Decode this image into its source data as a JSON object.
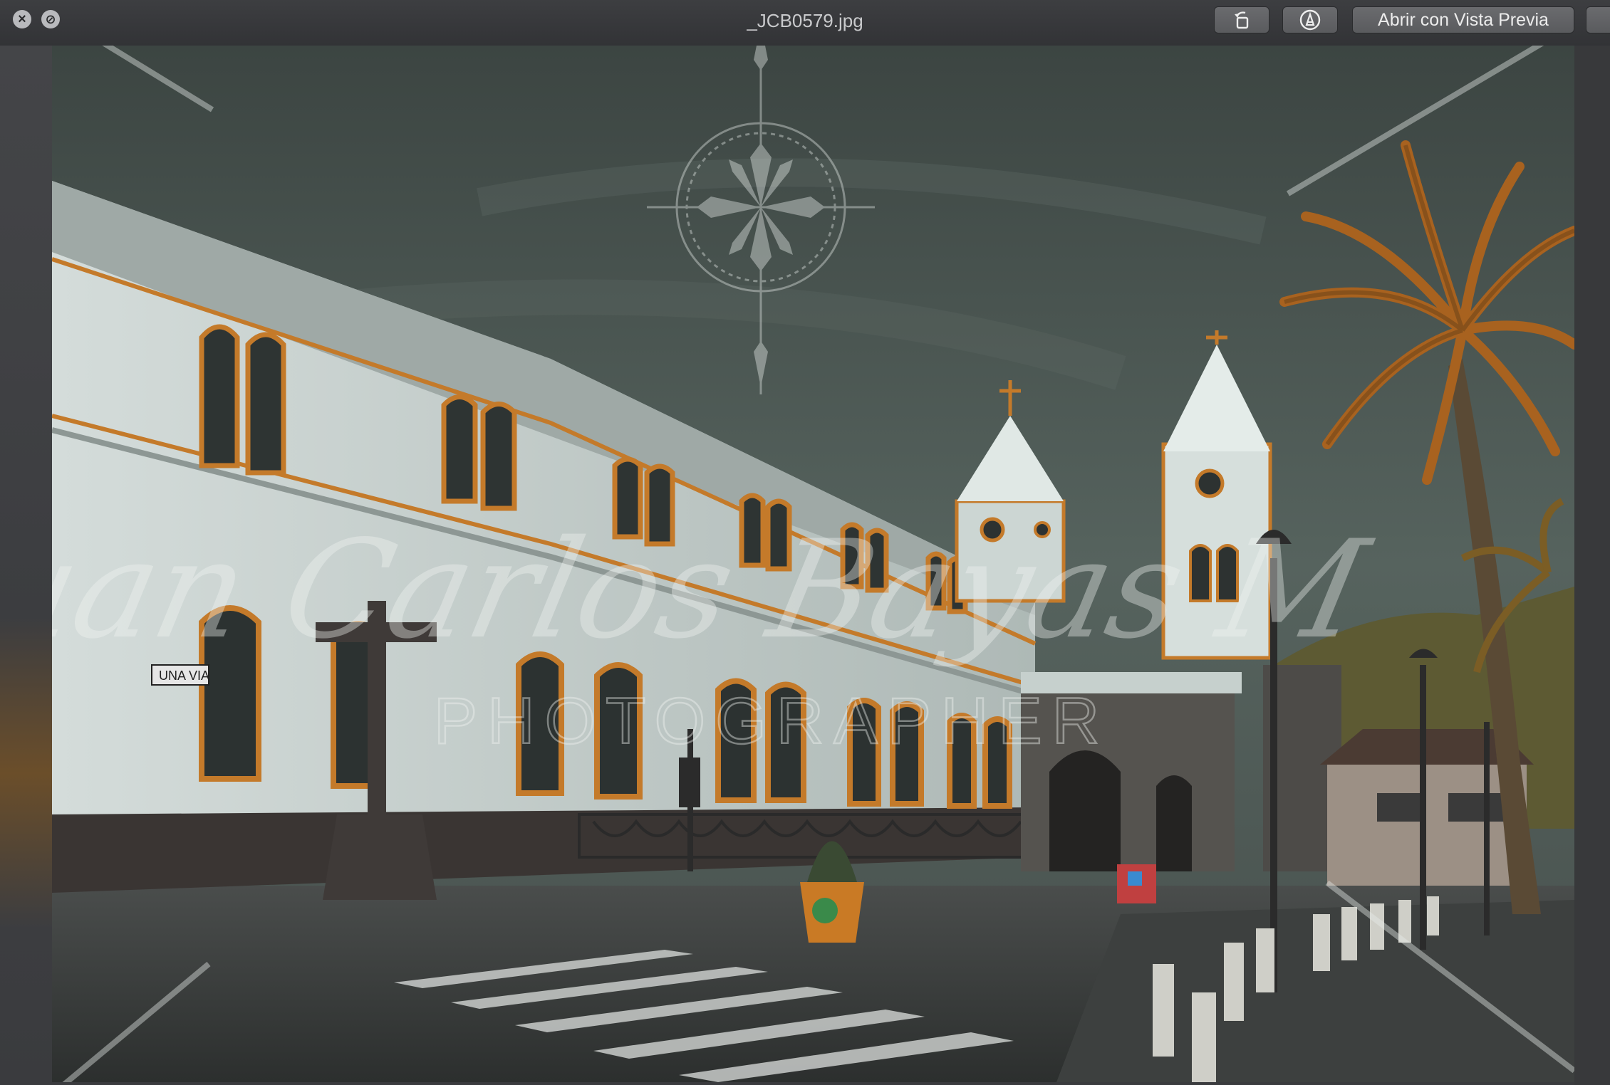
{
  "window": {
    "title": "_JCB0579.jpg",
    "close_symbol": "×",
    "fullscreen_symbol": "⊘"
  },
  "toolbar": {
    "rotate_icon": "rotate-left-icon",
    "markup_icon": "markup-pen-icon",
    "open_with_label": "Abrir con Vista Previa"
  },
  "photo": {
    "watermark_signature": "Juan Carlos Bayas M",
    "watermark_subtitle": "PHOTOGRAPHER",
    "street_sign": "UNA VIA"
  },
  "colors": {
    "sky": "#4a5651",
    "building": "#c8d2cf",
    "trim": "#c47a2a",
    "palm": "#a8621f"
  }
}
